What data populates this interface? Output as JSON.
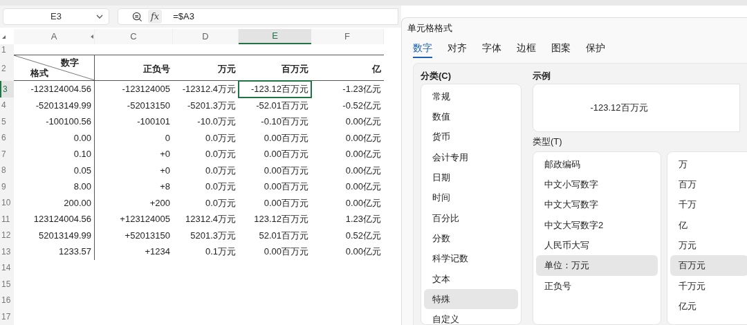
{
  "name_box": {
    "value": "E3"
  },
  "formula": {
    "function_button": "fx",
    "value": "=$A3"
  },
  "columns": [
    {
      "label": "A",
      "selected": false
    },
    {
      "label": "C",
      "selected": false
    },
    {
      "label": "D",
      "selected": false
    },
    {
      "label": "E",
      "selected": true
    },
    {
      "label": "F",
      "selected": false
    }
  ],
  "row_headers": [
    {
      "label": "1",
      "selected": false
    },
    {
      "label": "2",
      "selected": false
    },
    {
      "label": "3",
      "selected": true
    },
    {
      "label": "4",
      "selected": false
    },
    {
      "label": "5",
      "selected": false
    },
    {
      "label": "6",
      "selected": false
    },
    {
      "label": "7",
      "selected": false
    },
    {
      "label": "8",
      "selected": false
    },
    {
      "label": "9",
      "selected": false
    },
    {
      "label": "10",
      "selected": false
    },
    {
      "label": "11",
      "selected": false
    },
    {
      "label": "12",
      "selected": false
    },
    {
      "label": "13",
      "selected": false
    },
    {
      "label": "14",
      "selected": false
    },
    {
      "label": "15",
      "selected": false
    },
    {
      "label": "16",
      "selected": false
    },
    {
      "label": "17",
      "selected": false
    }
  ],
  "header": {
    "diagonal_top": "数字",
    "diagonal_bottom": "格式",
    "cells": [
      "正负号",
      "万元",
      "百万元",
      "亿"
    ]
  },
  "data": [
    {
      "cells": [
        {
          "text": "-123124004.56",
          "selected": false
        },
        {
          "text": "-123124005",
          "selected": false
        },
        {
          "text": "-12312.4万元",
          "selected": false
        },
        {
          "text": "-123.12百万元",
          "selected": true
        },
        {
          "text": "-1.23亿元",
          "selected": false
        }
      ]
    },
    {
      "cells": [
        {
          "text": "-52013149.99",
          "selected": false
        },
        {
          "text": "-52013150",
          "selected": false
        },
        {
          "text": "-5201.3万元",
          "selected": false
        },
        {
          "text": "-52.01百万元",
          "selected": false
        },
        {
          "text": "-0.52亿元",
          "selected": false
        }
      ]
    },
    {
      "cells": [
        {
          "text": "-100100.56",
          "selected": false
        },
        {
          "text": "-100101",
          "selected": false
        },
        {
          "text": "-10.0万元",
          "selected": false
        },
        {
          "text": "-0.10百万元",
          "selected": false
        },
        {
          "text": "0.00亿元",
          "selected": false
        }
      ]
    },
    {
      "cells": [
        {
          "text": "0.00",
          "selected": false
        },
        {
          "text": "0",
          "selected": false
        },
        {
          "text": "0.0万元",
          "selected": false
        },
        {
          "text": "0.00百万元",
          "selected": false
        },
        {
          "text": "0.00亿元",
          "selected": false
        }
      ]
    },
    {
      "cells": [
        {
          "text": "0.10",
          "selected": false
        },
        {
          "text": "+0",
          "selected": false
        },
        {
          "text": "0.0万元",
          "selected": false
        },
        {
          "text": "0.00百万元",
          "selected": false
        },
        {
          "text": "0.00亿元",
          "selected": false
        }
      ]
    },
    {
      "cells": [
        {
          "text": "0.05",
          "selected": false
        },
        {
          "text": "+0",
          "selected": false
        },
        {
          "text": "0.0万元",
          "selected": false
        },
        {
          "text": "0.00百万元",
          "selected": false
        },
        {
          "text": "0.00亿元",
          "selected": false
        }
      ]
    },
    {
      "cells": [
        {
          "text": "8.00",
          "selected": false
        },
        {
          "text": "+8",
          "selected": false
        },
        {
          "text": "0.0万元",
          "selected": false
        },
        {
          "text": "0.00百万元",
          "selected": false
        },
        {
          "text": "0.00亿元",
          "selected": false
        }
      ]
    },
    {
      "cells": [
        {
          "text": "200.00",
          "selected": false
        },
        {
          "text": "+200",
          "selected": false
        },
        {
          "text": "0.0万元",
          "selected": false
        },
        {
          "text": "0.00百万元",
          "selected": false
        },
        {
          "text": "0.00亿元",
          "selected": false
        }
      ]
    },
    {
      "cells": [
        {
          "text": "123124004.56",
          "selected": false
        },
        {
          "text": "+123124005",
          "selected": false
        },
        {
          "text": "12312.4万元",
          "selected": false
        },
        {
          "text": "123.12百万元",
          "selected": false
        },
        {
          "text": "1.23亿元",
          "selected": false
        }
      ]
    },
    {
      "cells": [
        {
          "text": "52013149.99",
          "selected": false
        },
        {
          "text": "+52013150",
          "selected": false
        },
        {
          "text": "5201.3万元",
          "selected": false
        },
        {
          "text": "52.01百万元",
          "selected": false
        },
        {
          "text": "0.52亿元",
          "selected": false
        }
      ]
    },
    {
      "cells": [
        {
          "text": "1233.57",
          "selected": false
        },
        {
          "text": "+1234",
          "selected": false
        },
        {
          "text": "0.1万元",
          "selected": false
        },
        {
          "text": "0.00百万元",
          "selected": false
        },
        {
          "text": "0.00亿元",
          "selected": false
        }
      ]
    }
  ],
  "dialog": {
    "title": "单元格格式",
    "tabs": [
      {
        "label": "数字",
        "selected": true
      },
      {
        "label": "对齐",
        "selected": false
      },
      {
        "label": "字体",
        "selected": false
      },
      {
        "label": "边框",
        "selected": false
      },
      {
        "label": "图案",
        "selected": false
      },
      {
        "label": "保护",
        "selected": false
      }
    ],
    "category_label": "分类(C)",
    "categories": [
      {
        "label": "常规",
        "selected": false
      },
      {
        "label": "数值",
        "selected": false
      },
      {
        "label": "货币",
        "selected": false
      },
      {
        "label": "会计专用",
        "selected": false
      },
      {
        "label": "日期",
        "selected": false
      },
      {
        "label": "时间",
        "selected": false
      },
      {
        "label": "百分比",
        "selected": false
      },
      {
        "label": "分数",
        "selected": false
      },
      {
        "label": "科学记数",
        "selected": false
      },
      {
        "label": "文本",
        "selected": false
      },
      {
        "label": "特殊",
        "selected": true
      },
      {
        "label": "自定义",
        "selected": false
      }
    ],
    "example_label": "示例",
    "example_value": "-123.12百万元",
    "type_label": "类型(T)",
    "types": [
      {
        "label": "邮政编码",
        "selected": false
      },
      {
        "label": "中文小写数字",
        "selected": false
      },
      {
        "label": "中文大写数字",
        "selected": false
      },
      {
        "label": "中文大写数字2",
        "selected": false
      },
      {
        "label": "人民币大写",
        "selected": false
      },
      {
        "label": "单位：万元",
        "selected": true
      },
      {
        "label": "正负号",
        "selected": false
      }
    ],
    "units": [
      {
        "label": "万",
        "selected": false
      },
      {
        "label": "百万",
        "selected": false
      },
      {
        "label": "千万",
        "selected": false
      },
      {
        "label": "亿",
        "selected": false
      },
      {
        "label": "万元",
        "selected": false
      },
      {
        "label": "百万元",
        "selected": true
      },
      {
        "label": "千万元",
        "selected": false
      },
      {
        "label": "亿元",
        "selected": false
      }
    ]
  }
}
